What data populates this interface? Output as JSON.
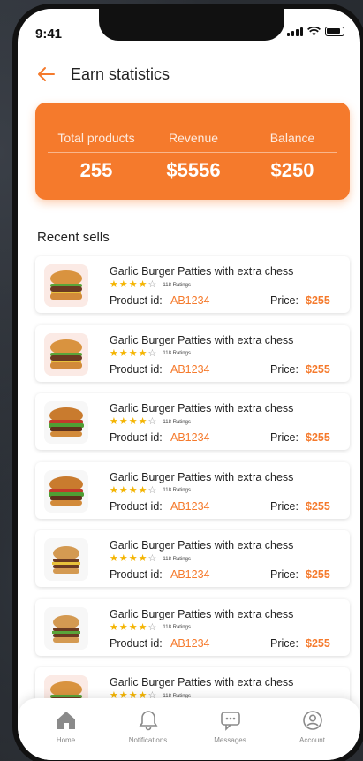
{
  "status_bar": {
    "time": "9:41"
  },
  "header": {
    "title": "Earn statistics",
    "back_icon": "arrow-left-icon"
  },
  "stats": [
    {
      "label": "Total products",
      "value": "255"
    },
    {
      "label": "Revenue",
      "value": "$5556"
    },
    {
      "label": "Balance",
      "value": "$250"
    }
  ],
  "section_title": "Recent sells",
  "items": [
    {
      "title": "Garlic Burger Patties with extra chess",
      "rating_stars": 4,
      "ratings_text": "118 Ratings",
      "product_id_label": "Product id:",
      "product_id": "AB1234",
      "price_label": "Price:",
      "price": "$255"
    },
    {
      "title": "Garlic Burger Patties with extra chess",
      "rating_stars": 4,
      "ratings_text": "118 Ratings",
      "product_id_label": "Product id:",
      "product_id": "AB1234",
      "price_label": "Price:",
      "price": "$255"
    },
    {
      "title": "Garlic Burger Patties with extra chess",
      "rating_stars": 4,
      "ratings_text": "118 Ratings",
      "product_id_label": "Product id:",
      "product_id": "AB1234",
      "price_label": "Price:",
      "price": "$255"
    },
    {
      "title": "Garlic Burger Patties with extra chess",
      "rating_stars": 4,
      "ratings_text": "118 Ratings",
      "product_id_label": "Product id:",
      "product_id": "AB1234",
      "price_label": "Price:",
      "price": "$255"
    },
    {
      "title": "Garlic Burger Patties with extra chess",
      "rating_stars": 4,
      "ratings_text": "118 Ratings",
      "product_id_label": "Product id:",
      "product_id": "AB1234",
      "price_label": "Price:",
      "price": "$255"
    },
    {
      "title": "Garlic Burger Patties with extra chess",
      "rating_stars": 4,
      "ratings_text": "118 Ratings",
      "product_id_label": "Product id:",
      "product_id": "AB1234",
      "price_label": "Price:",
      "price": "$255"
    },
    {
      "title": "Garlic Burger Patties with extra chess",
      "rating_stars": 4,
      "ratings_text": "118 Ratings"
    }
  ],
  "nav": [
    {
      "label": "Home",
      "icon": "home-icon"
    },
    {
      "label": "Notifications",
      "icon": "bell-icon"
    },
    {
      "label": "Messages",
      "icon": "chat-icon"
    },
    {
      "label": "Account",
      "icon": "user-icon"
    }
  ],
  "colors": {
    "accent": "#f57a2c",
    "star": "#f4b400"
  }
}
